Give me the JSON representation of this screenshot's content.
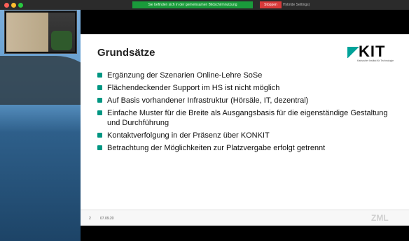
{
  "window": {
    "sharing_banner": "Sie befinden sich in der gemeinsamen Bildschirmnutzung",
    "stop_share_label": "Stoppen",
    "title": "Hybride Settings)"
  },
  "slide": {
    "title": "Grundsätze",
    "bullets": [
      "Ergänzung der Szenarien Online-Lehre SoSe",
      "Flächendeckender Support im HS ist nicht möglich",
      "Auf Basis vorhandener Infrastruktur (Hörsäle, IT, dezentral)",
      "Einfache Muster für die Breite als Ausgangsbasis für die eigenständige Gestaltung und Durchführung",
      "Kontaktverfolgung in der Präsenz über KONKIT",
      "Betrachtung der Möglichkeiten zur Platzvergabe erfolgt getrennt"
    ],
    "page_number": "2",
    "date": "07.09.20",
    "kit_logo": {
      "wordmark": "KIT",
      "subtitle": "Karlsruher Institut für Technologie"
    },
    "zml_logo": "ZML"
  },
  "colors": {
    "accent": "#009682",
    "share_green": "#1a9b3b",
    "stop_red": "#d83a3a"
  }
}
